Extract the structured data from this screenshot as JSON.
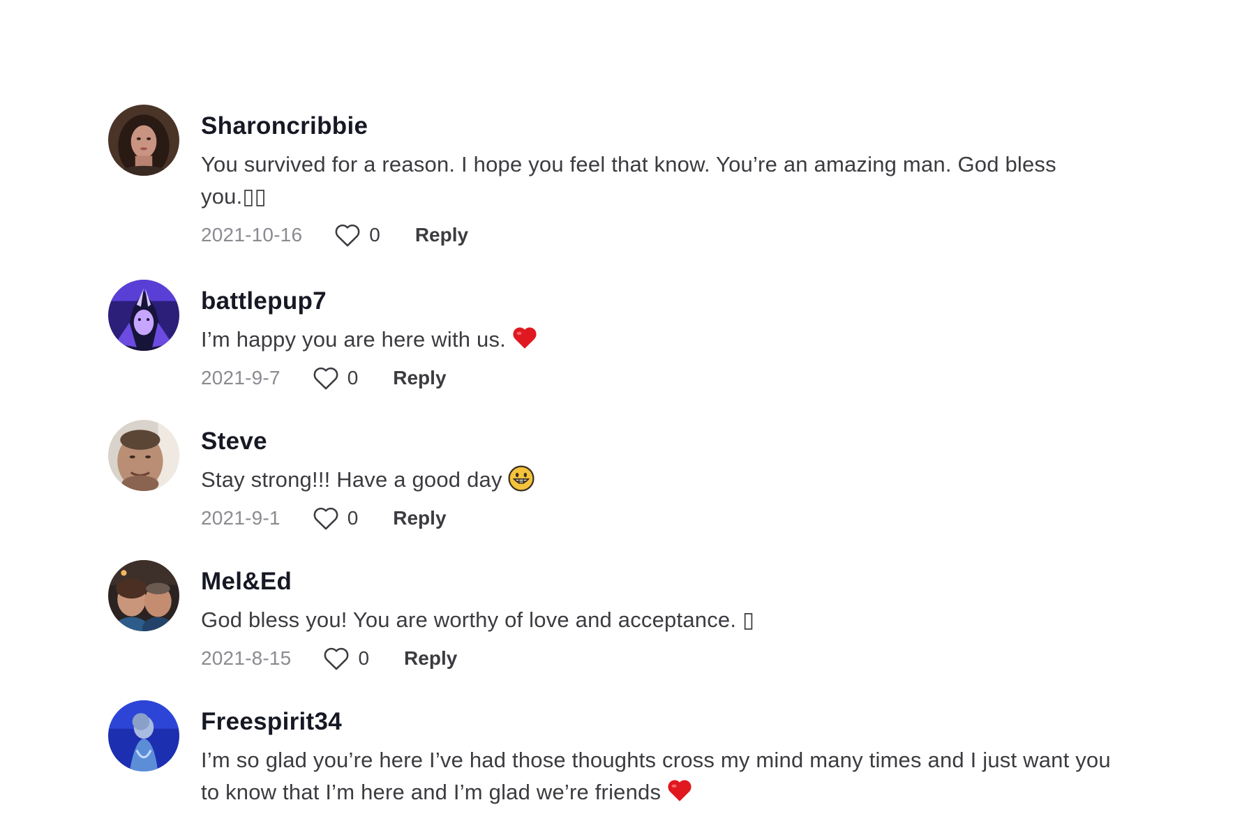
{
  "comments": [
    {
      "username": "Sharoncribbie",
      "text": "You survived for a reason. I hope you feel that know. You’re an amazing man. God bless you.▯▯",
      "date": "2021-10-16",
      "likes": "0",
      "reply_label": "Reply",
      "avatar_icon": "woman-portrait-avatar"
    },
    {
      "username": "battlepup7",
      "text": "I’m happy you are here with us.",
      "emoji": "red-heart-icon",
      "date": "2021-9-7",
      "likes": "0",
      "reply_label": "Reply",
      "avatar_icon": "anime-character-avatar"
    },
    {
      "username": "Steve",
      "text": "Stay strong!!! Have a good day",
      "emoji": "grinning-face-icon",
      "date": "2021-9-1",
      "likes": "0",
      "reply_label": "Reply",
      "avatar_icon": "man-selfie-avatar"
    },
    {
      "username": "Mel&Ed",
      "text": "God bless you! You are worthy of love and acceptance. ▯",
      "date": "2021-8-15",
      "likes": "0",
      "reply_label": "Reply",
      "avatar_icon": "couple-selfie-avatar"
    },
    {
      "username": "Freespirit34",
      "text": "I’m so glad you’re here I’ve had those thoughts cross my mind many times and I just want you to know that I’m here and I’m glad we’re friends",
      "emoji": "red-heart-icon",
      "avatar_icon": "blue-photo-avatar"
    }
  ],
  "colors": {
    "username": "#161823",
    "text": "#3b3b40",
    "date": "#8a8b91",
    "heart_emoji": "#e0181f"
  }
}
